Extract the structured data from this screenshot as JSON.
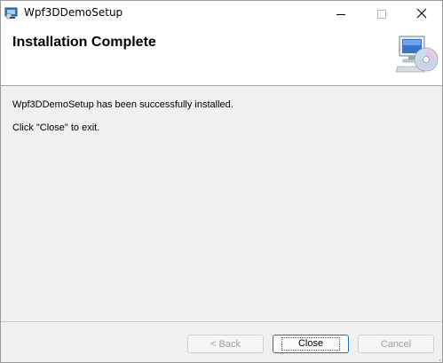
{
  "window": {
    "title": "Wpf3DDemoSetup",
    "controls": [
      "minimize-icon",
      "maximize-icon",
      "close-icon"
    ]
  },
  "banner": {
    "title": "Installation Complete",
    "icon": "computer-cd-icon"
  },
  "body": {
    "message": "Wpf3DDemoSetup has been successfully installed.",
    "instruction": "Click \"Close\" to exit."
  },
  "footer": {
    "back_label": "< Back",
    "close_label": "Close",
    "cancel_label": "Cancel"
  },
  "colors": {
    "body_bg": "#f0f0f0",
    "default_button_border": "#1a6fc9",
    "disabled_text": "#9e9e9e"
  }
}
